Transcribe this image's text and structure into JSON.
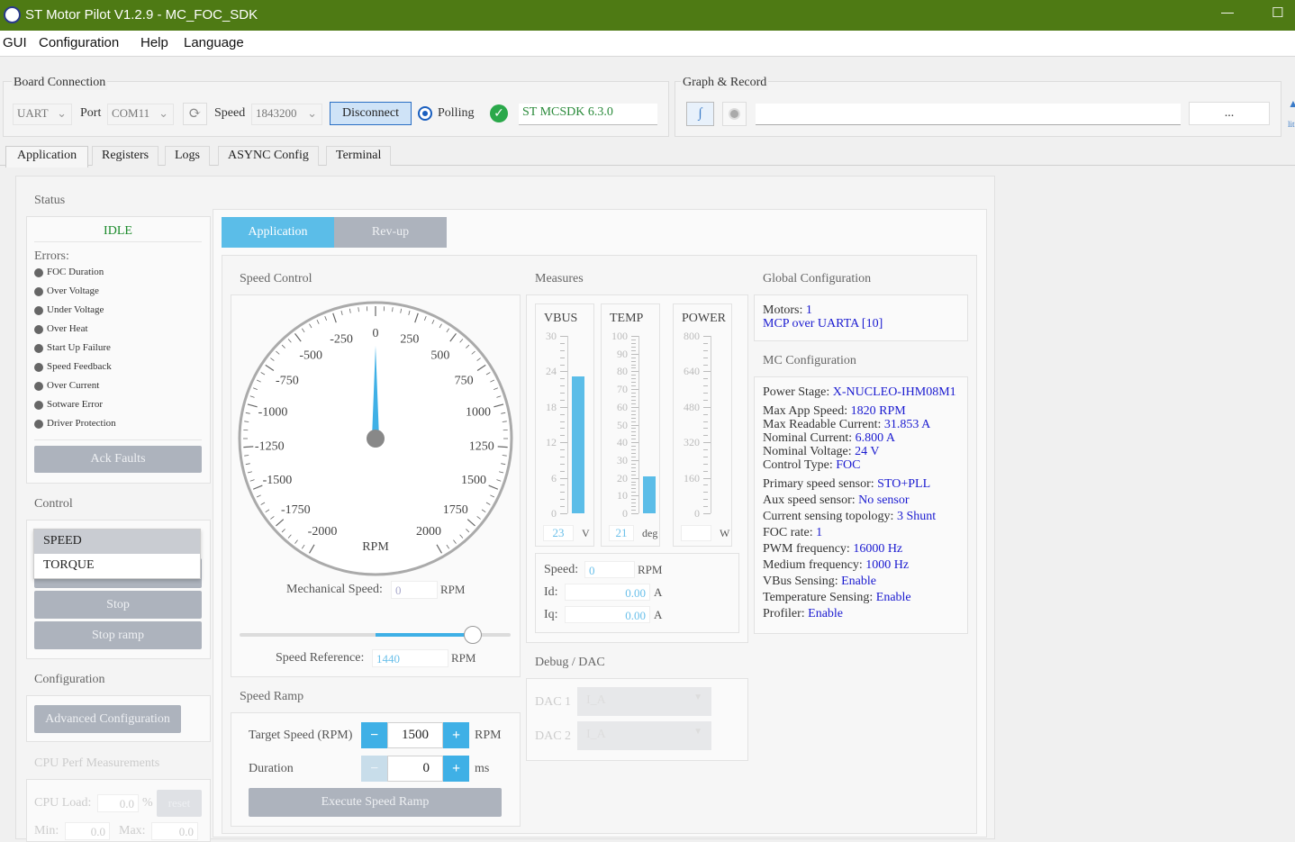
{
  "window": {
    "title": "ST Motor Pilot V1.2.9 - MC_FOC_SDK",
    "minimize": "—",
    "maximize": "☐"
  },
  "menu": [
    "GUI",
    "Configuration",
    "Help",
    "Language"
  ],
  "board": {
    "title": "Board Connection",
    "interface": "UART",
    "port_label": "Port",
    "port": "COM11",
    "speed_label": "Speed",
    "speed": "1843200",
    "disconnect": "Disconnect",
    "polling": "Polling",
    "sdk": "ST MCSDK 6.3.0"
  },
  "graph": {
    "title": "Graph & Record",
    "path": "",
    "browse": "...",
    "side_text": "lit"
  },
  "tabs": [
    "Application",
    "Registers",
    "Logs",
    "ASYNC Config",
    "Terminal"
  ],
  "status": {
    "title": "Status",
    "state": "IDLE",
    "errors_label": "Errors:",
    "errors": [
      "FOC Duration",
      "Over Voltage",
      "Under Voltage",
      "Over Heat",
      "Start Up Failure",
      "Speed Feedback",
      "Over Current",
      "Sotware Error",
      "Driver Protection"
    ],
    "ack": "Ack Faults"
  },
  "control": {
    "title": "Control",
    "modes": [
      "SPEED",
      "TORQUE"
    ],
    "stop": "Stop",
    "stop_ramp": "Stop ramp"
  },
  "configuration": {
    "title": "Configuration",
    "advanced": "Advanced Configuration"
  },
  "cpu": {
    "title": "CPU Perf Measurements",
    "load_label": "CPU Load:",
    "load": "0.0",
    "pct": "%",
    "reset": "reset",
    "min_label": "Min:",
    "min": "0.0",
    "max_label": "Max:",
    "max": "0.0"
  },
  "subtabs": [
    "Application",
    "Rev-up"
  ],
  "speed_control": {
    "title": "Speed Control",
    "gauge_unit": "RPM",
    "gauge_labels": [
      "-2000",
      "-1750",
      "-1500",
      "-1250",
      "-1000",
      "-750",
      "-500",
      "-250",
      "0",
      "250",
      "500",
      "750",
      "1000",
      "1250",
      "1500",
      "1750",
      "2000"
    ],
    "needle_value": 0,
    "mech_label": "Mechanical Speed:",
    "mech_value": "0",
    "mech_unit": "RPM",
    "slider_fraction": 0.86,
    "ref_label": "Speed Reference:",
    "ref_value": "1440",
    "ref_unit": "RPM"
  },
  "speed_ramp": {
    "title": "Speed Ramp",
    "target_label": "Target Speed (RPM)",
    "target": "1500",
    "target_unit": "RPM",
    "duration_label": "Duration",
    "duration": "0",
    "duration_unit": "ms",
    "minus": "−",
    "plus": "+",
    "execute": "Execute Speed Ramp"
  },
  "measures": {
    "title": "Measures",
    "vbus": {
      "label": "VBUS",
      "ticks": [
        "30",
        "24",
        "18",
        "12",
        "6",
        "0"
      ],
      "value": "23",
      "unit": "V",
      "fill": 0.77
    },
    "temp": {
      "label": "TEMP",
      "ticks": [
        "100",
        "90",
        "80",
        "70",
        "60",
        "50",
        "40",
        "30",
        "20",
        "10",
        "0"
      ],
      "value": "21",
      "unit": "deg",
      "fill": 0.21
    },
    "power": {
      "label": "POWER",
      "ticks": [
        "800",
        "640",
        "480",
        "320",
        "160",
        "0"
      ],
      "value": "",
      "unit": "W",
      "fill": 0
    },
    "speed_label": "Speed:",
    "speed": "0",
    "speed_unit": "RPM",
    "id_label": "Id:",
    "id": "0.00",
    "id_unit": "A",
    "iq_label": "Iq:",
    "iq": "0.00",
    "iq_unit": "A"
  },
  "debug": {
    "title": "Debug / DAC",
    "dac1_label": "DAC 1",
    "dac1": "I_A",
    "dac2_label": "DAC 2",
    "dac2": "I_A"
  },
  "global": {
    "title": "Global Configuration",
    "motors_label": "Motors:",
    "motors": "1",
    "mcp": "MCP over UARTA [10]"
  },
  "mc": {
    "title": "MC Configuration",
    "rows": [
      {
        "k": "Power Stage:",
        "v": "X-NUCLEO-IHM08M1"
      },
      {
        "k": "Max App Speed:",
        "v": "1820 RPM"
      },
      {
        "k": "Max Readable Current:",
        "v": "31.853 A"
      },
      {
        "k": "Nominal Current:",
        "v": "6.800 A"
      },
      {
        "k": "Nominal Voltage:",
        "v": "24 V"
      },
      {
        "k": "Control Type:",
        "v": "FOC"
      },
      {
        "k": "Primary speed sensor:",
        "v": "STO+PLL"
      },
      {
        "k": "Aux speed sensor:",
        "v": "No sensor"
      },
      {
        "k": "Current sensing topology:",
        "v": "3 Shunt"
      },
      {
        "k": "FOC rate:",
        "v": "1"
      },
      {
        "k": "PWM frequency:",
        "v": "16000 Hz"
      },
      {
        "k": "Medium frequency:",
        "v": "1000 Hz"
      },
      {
        "k": "VBus Sensing:",
        "v": "Enable"
      },
      {
        "k": "Temperature Sensing:",
        "v": "Enable"
      },
      {
        "k": "Profiler:",
        "v": "Enable"
      }
    ]
  },
  "colors": {
    "titlebar": "#4e7a14",
    "accent": "#3fb0e6",
    "ok": "#2aa84a",
    "link": "#1a1ad0"
  }
}
